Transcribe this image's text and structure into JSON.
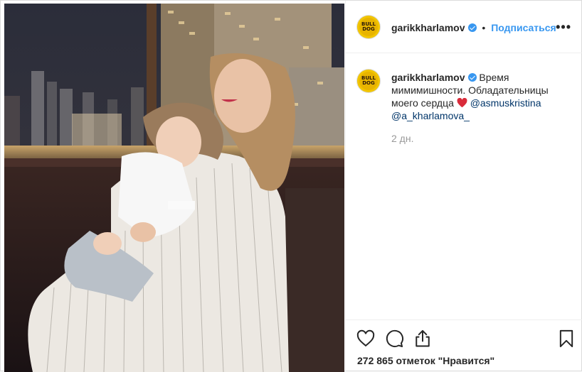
{
  "header": {
    "username": "garikkharlamov",
    "separator": "•",
    "follow_label": "Подписаться",
    "more_label": "•••",
    "avatar_text": "BULL DOG"
  },
  "caption": {
    "username": "garikkharlamov",
    "text": "Время мимимишности. Обладательницы моего сердца",
    "mention1": "@asmuskristina",
    "mention2": "@a_kharlamova_"
  },
  "meta": {
    "age": "2 дн."
  },
  "actions": {
    "likes": "272 865 отметок \"Нравится\""
  },
  "colors": {
    "accent": "#3897f0",
    "mention": "#003569",
    "muted": "#999999"
  }
}
